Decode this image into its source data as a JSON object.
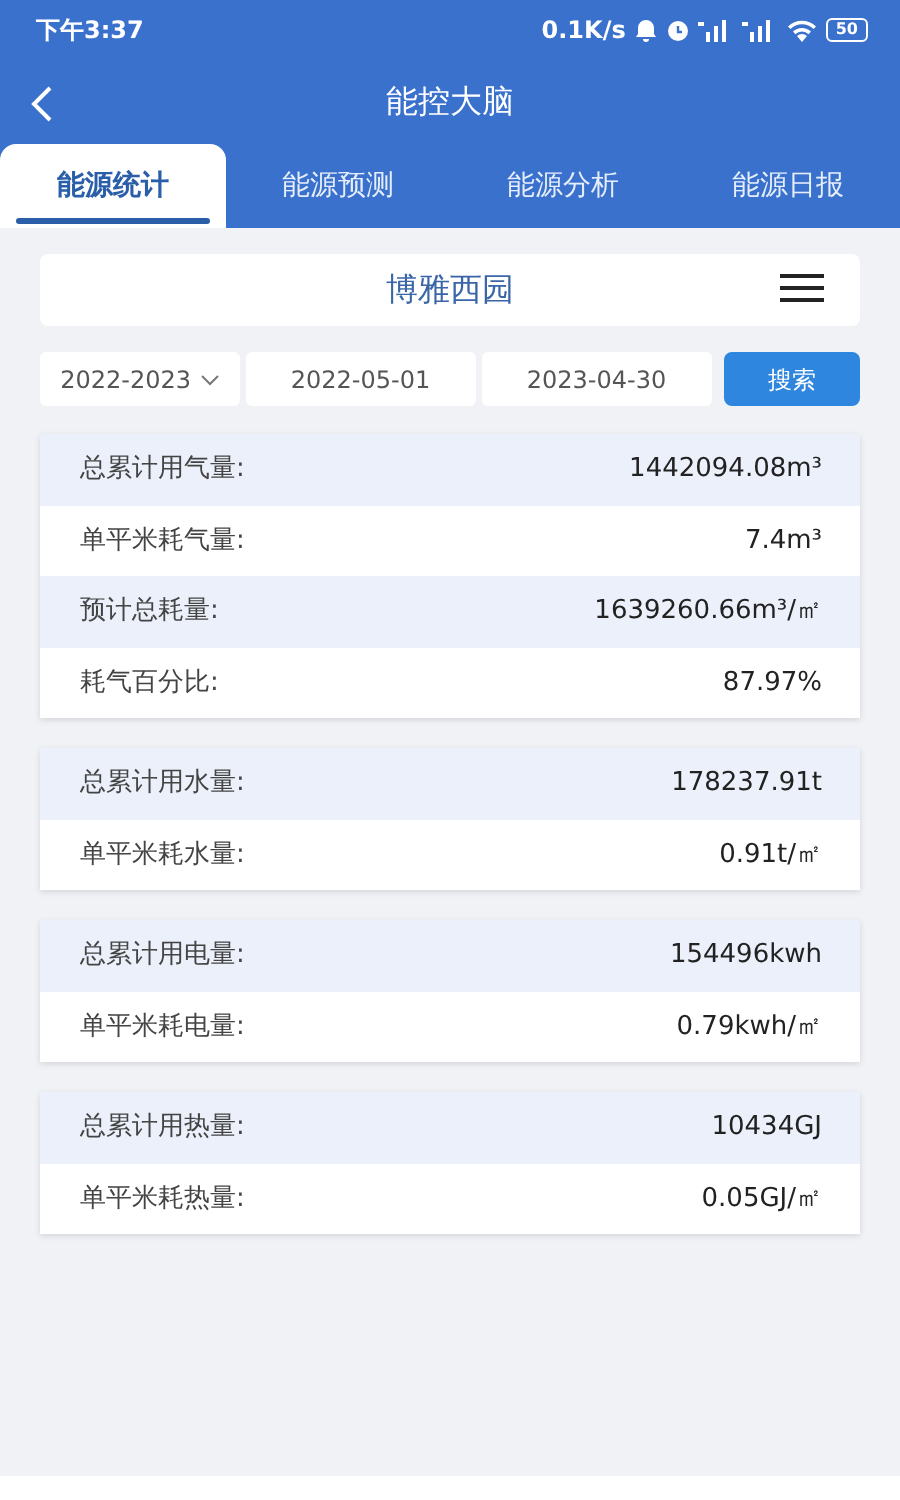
{
  "status_bar": {
    "time": "下午3:37",
    "speed": "0.1K/s",
    "battery": "50"
  },
  "header": {
    "title": "能控大脑"
  },
  "tabs": [
    {
      "label": "能源统计",
      "selected": true
    },
    {
      "label": "能源预测",
      "selected": false
    },
    {
      "label": "能源分析",
      "selected": false
    },
    {
      "label": "能源日报",
      "selected": false
    }
  ],
  "site": {
    "name": "博雅西园"
  },
  "filters": {
    "year": "2022-2023",
    "start_date": "2022-05-01",
    "end_date": "2023-04-30",
    "search_button": "搜索"
  },
  "groups": [
    {
      "rows": [
        {
          "label": "总累计用气量:",
          "value": "1442094.08m³"
        },
        {
          "label": "单平米耗气量:",
          "value": "7.4m³"
        },
        {
          "label": "预计总耗量:",
          "value": "1639260.66m³/㎡"
        },
        {
          "label": "耗气百分比:",
          "value": "87.97%"
        }
      ]
    },
    {
      "rows": [
        {
          "label": "总累计用水量:",
          "value": "178237.91t"
        },
        {
          "label": "单平米耗水量:",
          "value": "0.91t/㎡"
        }
      ]
    },
    {
      "rows": [
        {
          "label": "总累计用电量:",
          "value": "154496kwh"
        },
        {
          "label": "单平米耗电量:",
          "value": "0.79kwh/㎡"
        }
      ]
    },
    {
      "rows": [
        {
          "label": "总累计用热量:",
          "value": "10434GJ"
        },
        {
          "label": "单平米耗热量:",
          "value": "0.05GJ/㎡"
        }
      ]
    }
  ]
}
